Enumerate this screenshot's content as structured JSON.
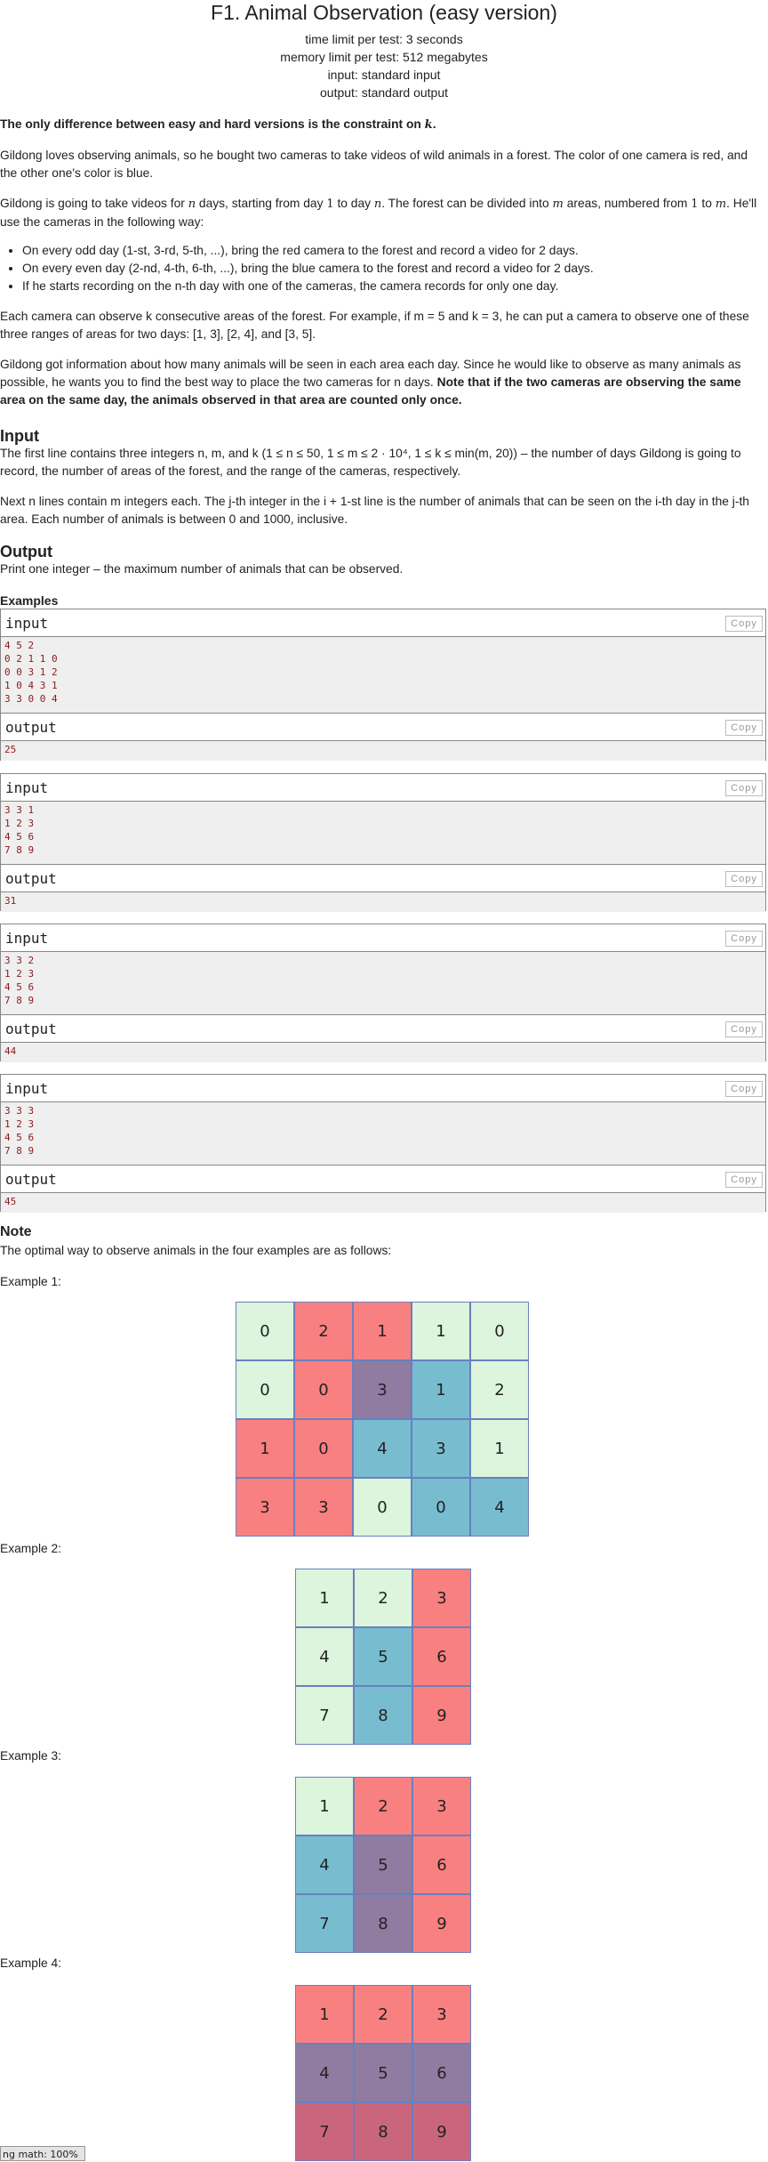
{
  "header": {
    "title": "F1. Animal Observation (easy version)",
    "time_limit": "time limit per test: 3 seconds",
    "memory_limit": "memory limit per test: 512 megabytes",
    "input": "input: standard input",
    "output": "output: standard output"
  },
  "statement": {
    "p1": "The only difference between easy and hard versions is the constraint on",
    "p1_var": "k",
    "p2": "Gildong loves observing animals, so he bought two cameras to take videos of wild animals in a forest. The color of one camera is red, and the other one's color is blue.",
    "p3a": "Gildong is going to take videos for",
    "p3b": "days, starting from day",
    "p3c": "to day",
    "p3d": ". The forest can be divided into",
    "p3e": "areas, numbered from",
    "p3f": "to",
    "p3g": ". He'll use the cameras in the following way:",
    "bullets": [
      "On every odd day (1-st, 3-rd, 5-th, ...), bring the red camera to the forest and record a video for 2 days.",
      "On every even day (2-nd, 4-th, 6-th, ...), bring the blue camera to the forest and record a video for 2 days.",
      "If he starts recording on the n-th day with one of the cameras, the camera records for only one day."
    ],
    "p4": "Each camera can observe k consecutive areas of the forest. For example, if m = 5 and k = 3, he can put a camera to observe one of these three ranges of areas for two days: [1, 3], [2, 4], and [3, 5].",
    "p5a": "Gildong got information about how many animals will be seen in each area each day. Since he would like to observe as many animals as possible, he wants you to find the best way to place the two cameras for n days.",
    "p5b": "Note that if the two cameras are observing the same area on the same day, the animals observed in that area are counted only once."
  },
  "input_section": {
    "heading": "Input",
    "p1": "The first line contains three integers n, m, and k (1 ≤ n ≤ 50, 1 ≤ m ≤ 2 · 10⁴, 1 ≤ k ≤ min(m, 20)) – the number of days Gildong is going to record, the number of areas of the forest, and the range of the cameras, respectively.",
    "p2": "Next n lines contain m integers each. The j-th integer in the i + 1-st line is the number of animals that can be seen on the i-th day in the j-th area. Each number of animals is between 0 and 1000, inclusive."
  },
  "output_section": {
    "heading": "Output",
    "p1": "Print one integer – the maximum number of animals that can be observed."
  },
  "examples": {
    "heading": "Examples",
    "input_label": "input",
    "output_label": "output",
    "copy_label": "Copy",
    "items": [
      {
        "input": "4 5 2\n0 2 1 1 0\n0 0 3 1 2\n1 0 4 3 1\n3 3 0 0 4",
        "output": "25"
      },
      {
        "input": "3 3 1\n1 2 3\n4 5 6\n7 8 9",
        "output": "31"
      },
      {
        "input": "3 3 2\n1 2 3\n4 5 6\n7 8 9",
        "output": "44"
      },
      {
        "input": "3 3 3\n1 2 3\n4 5 6\n7 8 9",
        "output": "45"
      }
    ]
  },
  "note": {
    "heading": "Note",
    "intro": "The optimal way to observe animals in the four examples are as follows:",
    "ex1_label": "Example 1:",
    "ex2_label": "Example 2:",
    "ex3_label": "Example 3:",
    "ex4_label": "Example 4:",
    "colors": {
      "none": "#dcf5dc",
      "red": "#f98080",
      "blue": "#78bcd0",
      "both": "#8f7ca0"
    },
    "grids": [
      {
        "rows": [
          [
            "0",
            "2",
            "1",
            "1",
            "0"
          ],
          [
            "0",
            "0",
            "3",
            "1",
            "2"
          ],
          [
            "1",
            "0",
            "4",
            "3",
            "1"
          ],
          [
            "3",
            "3",
            "0",
            "0",
            "4"
          ]
        ],
        "colors": [
          [
            "g",
            "r",
            "r",
            "g",
            "g"
          ],
          [
            "g",
            "r",
            "p",
            "b",
            "g"
          ],
          [
            "r",
            "r",
            "b",
            "b",
            "g"
          ],
          [
            "r",
            "r",
            "g",
            "b",
            "b"
          ]
        ]
      },
      {
        "rows": [
          [
            "1",
            "2",
            "3"
          ],
          [
            "4",
            "5",
            "6"
          ],
          [
            "7",
            "8",
            "9"
          ]
        ],
        "colors": [
          [
            "g",
            "g",
            "r"
          ],
          [
            "g",
            "b",
            "r"
          ],
          [
            "g",
            "b",
            "r"
          ]
        ]
      },
      {
        "rows": [
          [
            "1",
            "2",
            "3"
          ],
          [
            "4",
            "5",
            "6"
          ],
          [
            "7",
            "8",
            "9"
          ]
        ],
        "colors": [
          [
            "g",
            "r",
            "r"
          ],
          [
            "b",
            "p",
            "r"
          ],
          [
            "b",
            "p",
            "r"
          ]
        ]
      },
      {
        "rows": [
          [
            "1",
            "2",
            "3"
          ],
          [
            "4",
            "5",
            "6"
          ],
          [
            "7",
            "8",
            "9"
          ]
        ],
        "colors": [
          [
            "r",
            "r",
            "r"
          ],
          [
            "p",
            "p",
            "p"
          ],
          [
            "dr",
            "dr",
            "dr"
          ]
        ]
      }
    ]
  },
  "mathjax": "ng math: 100%"
}
